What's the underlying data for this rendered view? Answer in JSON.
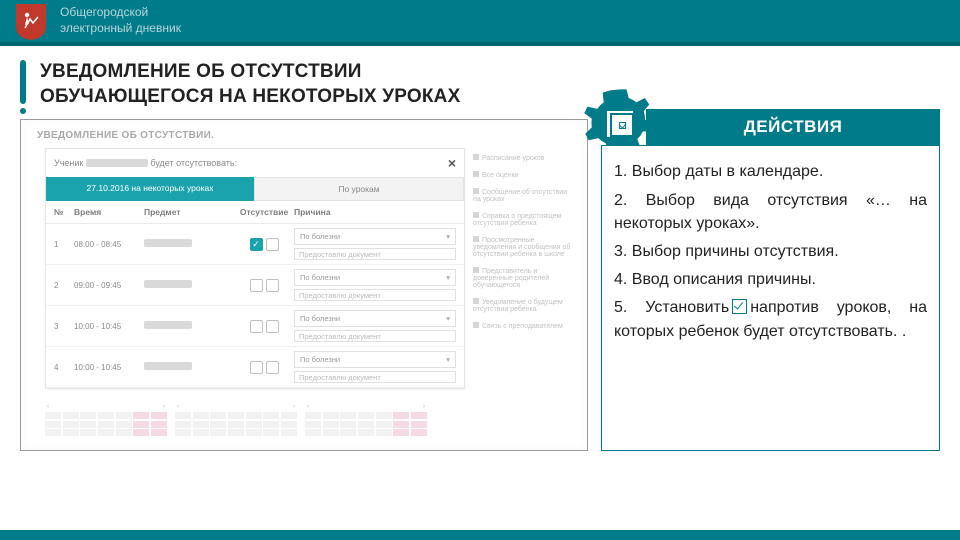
{
  "header": {
    "brand_line_1": "Общегородской",
    "brand_line_2": "электронный дневник"
  },
  "title": {
    "line1": "УВЕДОМЛЕНИЕ ОБ ОТСУТСТВИИ",
    "line2": "ОБУЧАЮЩЕГОСЯ НА НЕКОТОРЫХ УРОКАХ"
  },
  "mock": {
    "window_title": "УВЕДОМЛЕНИЕ ОБ ОТСУТСТВИИ.",
    "panel_head_prefix": "Ученик",
    "panel_head_suffix": "будет отсутствовать:",
    "tab_active": "27.10.2016 на некоторых уроках",
    "tab_inactive": "По урокам",
    "close": "×",
    "cols": {
      "n": "№",
      "time": "Время",
      "subj": "Предмет",
      "abs": "Отсутствие",
      "reason": "Причина"
    },
    "reason_option": "По болезни",
    "reason_placeholder": "Предоставлю документ",
    "rows": [
      {
        "n": "1",
        "time": "08:00 - 08:45",
        "checked": true
      },
      {
        "n": "2",
        "time": "09:00 - 09:45",
        "checked": false
      },
      {
        "n": "3",
        "time": "10:00 - 10:45",
        "checked": false
      },
      {
        "n": "4",
        "time": "10:00 - 10:45",
        "checked": false
      }
    ],
    "side_items": [
      "Расписание уроков",
      "Все оценки",
      "Сообщение об отсутствии на уроках",
      "Справка о предстоящем отсутствии ребенка",
      "Просмотренные уведомления и сообщения об отсутствии ребенка в школе",
      "Представитель и доверенные родителей обучающегося",
      "Уведомление о будущем отсутствии ребенка",
      "Связь с преподавателем"
    ]
  },
  "actions": {
    "title": "ДЕЙСТВИЯ",
    "step1": "1. Выбор даты в календаре.",
    "step2": "2. Выбор вида отсутствия «… на некоторых уроках».",
    "step3": "3. Выбор причины отсутствия.",
    "step4": "4. Ввод описания причины.",
    "step5_a": "5. Установить",
    "step5_b": "напротив уроков, на которых ребенок будет отсутствовать. ."
  }
}
